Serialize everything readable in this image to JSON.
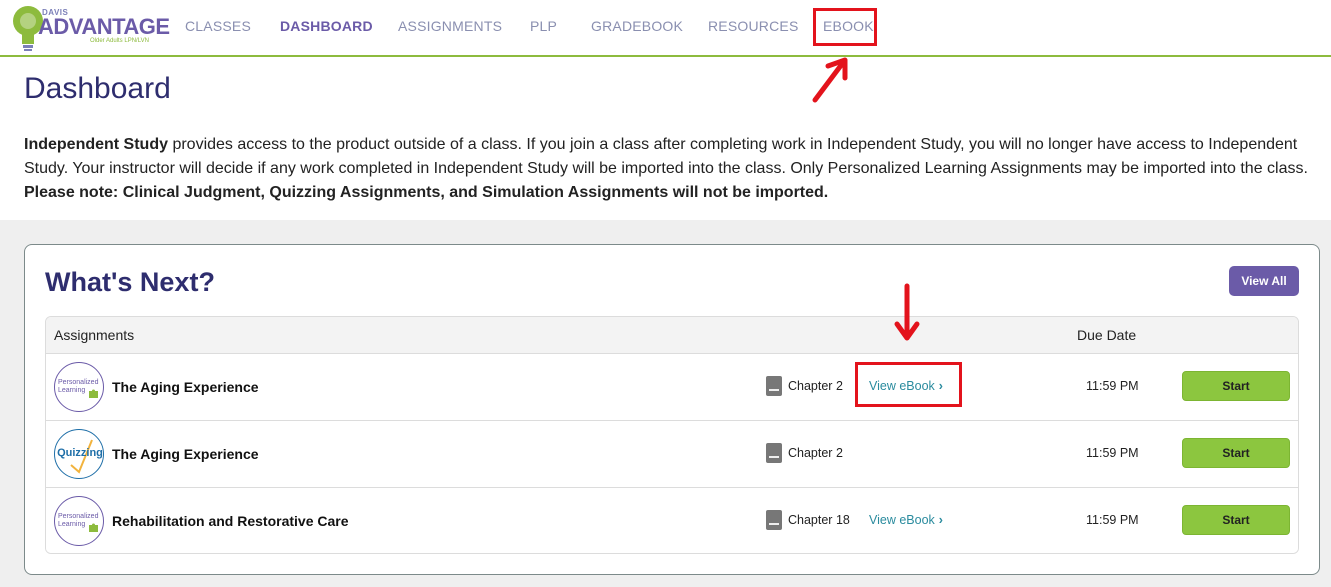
{
  "logo": {
    "brand": "DAVIS",
    "name": "ADVANTAGE",
    "subtitle": "Older Adults LPN/LVN"
  },
  "nav": [
    {
      "label": "CLASSES",
      "active": false
    },
    {
      "label": "DASHBOARD",
      "active": true
    },
    {
      "label": "ASSIGNMENTS",
      "active": false
    },
    {
      "label": "PLP",
      "active": false
    },
    {
      "label": "GRADEBOOK",
      "active": false
    },
    {
      "label": "RESOURCES",
      "active": false
    },
    {
      "label": "EBOOK",
      "active": false
    }
  ],
  "page": {
    "title": "Dashboard",
    "intro_bold": "Independent Study",
    "intro_text": " provides access to the product outside of a class. If you join a class after completing work in Independent Study, you will no longer have access to Independent Study. Your instructor will decide if any work completed in Independent Study will be imported into the class. Only Personalized Learning Assignments may be imported into the class.",
    "note": "Please note: Clinical Judgment, Quizzing Assignments, and Simulation Assignments will not be imported."
  },
  "whats_next": {
    "title": "What's Next?",
    "view_all_label": "View All",
    "col_assignments": "Assignments",
    "col_due": "Due Date",
    "rows": [
      {
        "badge": "Personalized Learning",
        "title": "The Aging Experience",
        "chapter": "Chapter 2",
        "ebook": "View eBook",
        "due": "11:59 PM",
        "start": "Start"
      },
      {
        "badge": "Quizzing",
        "title": "The Aging Experience",
        "chapter": "Chapter 2",
        "ebook": "",
        "due": "11:59 PM",
        "start": "Start"
      },
      {
        "badge": "Personalized Learning",
        "title": "Rehabilitation and Restorative Care",
        "chapter": "Chapter 18",
        "ebook": "View eBook",
        "due": "11:59 PM",
        "start": "Start"
      }
    ]
  },
  "colors": {
    "brand_purple": "#6b5ba8",
    "accent_green": "#8cc63f",
    "annotation_red": "#e3131c",
    "link_teal": "#2a8b9e"
  },
  "icons": [
    "lightbulb-logo-icon",
    "book-icon",
    "chevron-right-icon",
    "puzzle-icon",
    "checkmark-icon"
  ]
}
